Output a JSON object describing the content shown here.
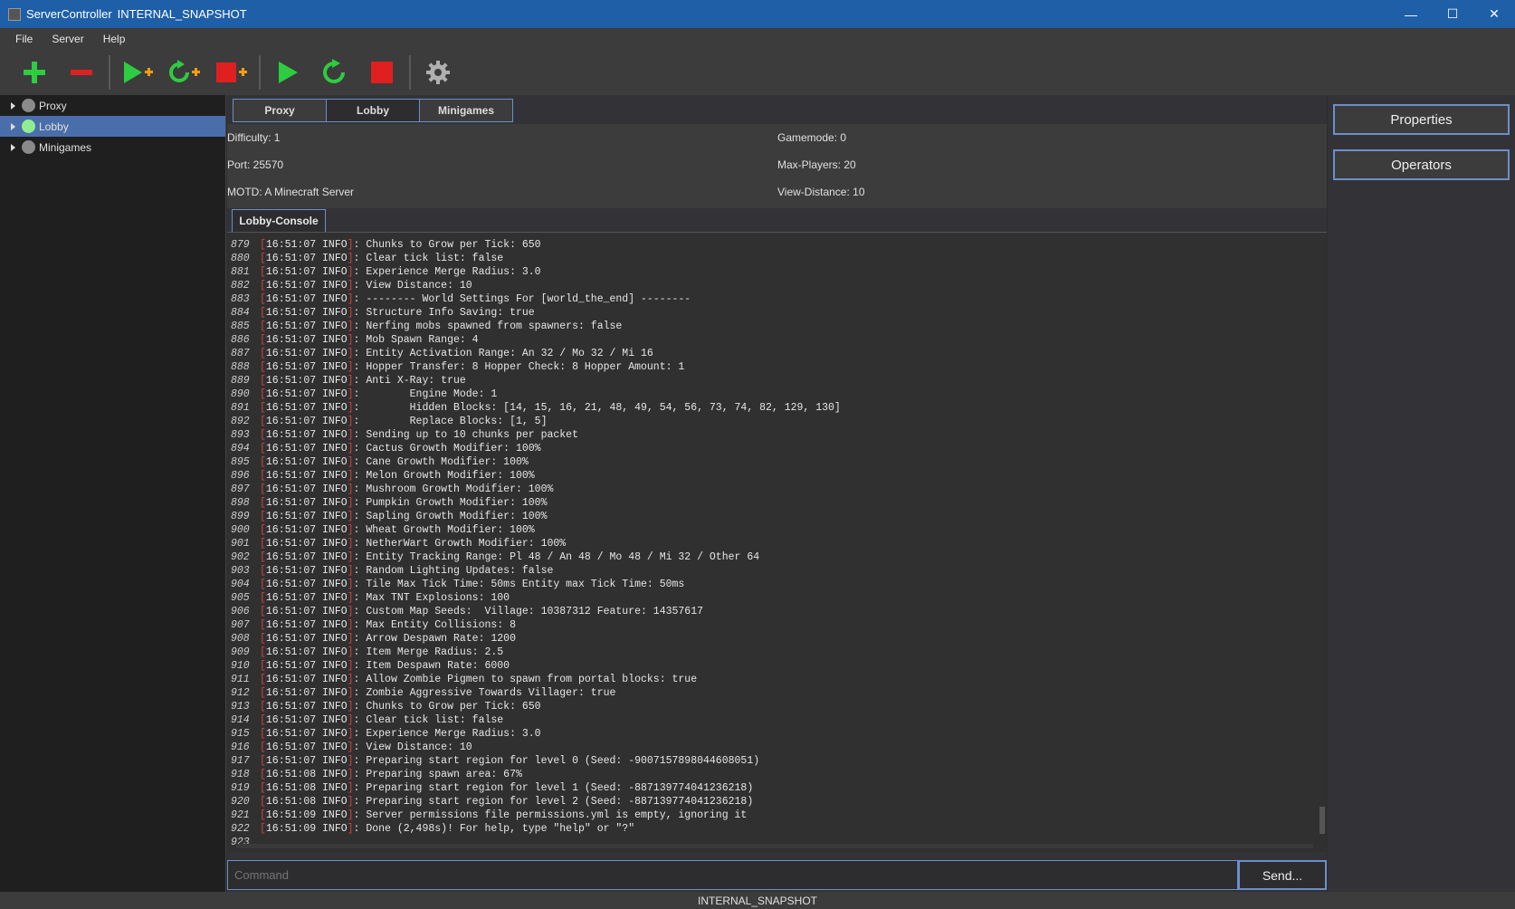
{
  "window": {
    "app_name": "ServerController",
    "title": "INTERNAL_SNAPSHOT",
    "minimize": "—",
    "maximize": "☐",
    "close": "✕"
  },
  "menu": [
    "File",
    "Server",
    "Help"
  ],
  "toolbar": {
    "icons": [
      "add-server-icon",
      "remove-server-icon",
      "start-all-icon",
      "restart-all-icon",
      "stop-all-icon",
      "start-icon",
      "restart-icon",
      "stop-icon",
      "settings-icon"
    ],
    "colors": {
      "green": "#2ecc40",
      "red": "#e02020",
      "orange": "#f39c12",
      "gray": "#b0b0b0"
    }
  },
  "tree": {
    "items": [
      {
        "label": "Proxy",
        "status_color": "#8a8a8a",
        "selected": false
      },
      {
        "label": "Lobby",
        "status_color": "#90ee90",
        "selected": true
      },
      {
        "label": "Minigames",
        "status_color": "#8a8a8a",
        "selected": false
      }
    ]
  },
  "tabs": [
    {
      "label": "Proxy",
      "active": false
    },
    {
      "label": "Lobby",
      "active": true
    },
    {
      "label": "Minigames",
      "active": false
    }
  ],
  "info": {
    "difficulty": "Difficulty: 1",
    "gamemode": "Gamemode: 0",
    "port": "Port: 25570",
    "max_players": "Max-Players: 20",
    "motd": "MOTD: A Minecraft Server",
    "view_distance": "View-Distance: 10"
  },
  "console": {
    "tab_label": "Lobby-Console",
    "lines": [
      {
        "n": "879",
        "t": "16:51:07",
        "lv": "INFO",
        "msg": ": Chunks to Grow per Tick: 650"
      },
      {
        "n": "880",
        "t": "16:51:07",
        "lv": "INFO",
        "msg": ": Clear tick list: false"
      },
      {
        "n": "881",
        "t": "16:51:07",
        "lv": "INFO",
        "msg": ": Experience Merge Radius: 3.0"
      },
      {
        "n": "882",
        "t": "16:51:07",
        "lv": "INFO",
        "msg": ": View Distance: 10"
      },
      {
        "n": "883",
        "t": "16:51:07",
        "lv": "INFO",
        "msg": ": -------- World Settings For [world_the_end] --------"
      },
      {
        "n": "884",
        "t": "16:51:07",
        "lv": "INFO",
        "msg": ": Structure Info Saving: true"
      },
      {
        "n": "885",
        "t": "16:51:07",
        "lv": "INFO",
        "msg": ": Nerfing mobs spawned from spawners: false"
      },
      {
        "n": "886",
        "t": "16:51:07",
        "lv": "INFO",
        "msg": ": Mob Spawn Range: 4"
      },
      {
        "n": "887",
        "t": "16:51:07",
        "lv": "INFO",
        "msg": ": Entity Activation Range: An 32 / Mo 32 / Mi 16"
      },
      {
        "n": "888",
        "t": "16:51:07",
        "lv": "INFO",
        "msg": ": Hopper Transfer: 8 Hopper Check: 8 Hopper Amount: 1"
      },
      {
        "n": "889",
        "t": "16:51:07",
        "lv": "INFO",
        "msg": ": Anti X-Ray: true"
      },
      {
        "n": "890",
        "t": "16:51:07",
        "lv": "INFO",
        "msg": ":        Engine Mode: 1"
      },
      {
        "n": "891",
        "t": "16:51:07",
        "lv": "INFO",
        "msg": ":        Hidden Blocks: [14, 15, 16, 21, 48, 49, 54, 56, 73, 74, 82, 129, 130]"
      },
      {
        "n": "892",
        "t": "16:51:07",
        "lv": "INFO",
        "msg": ":        Replace Blocks: [1, 5]"
      },
      {
        "n": "893",
        "t": "16:51:07",
        "lv": "INFO",
        "msg": ": Sending up to 10 chunks per packet"
      },
      {
        "n": "894",
        "t": "16:51:07",
        "lv": "INFO",
        "msg": ": Cactus Growth Modifier: 100%"
      },
      {
        "n": "895",
        "t": "16:51:07",
        "lv": "INFO",
        "msg": ": Cane Growth Modifier: 100%"
      },
      {
        "n": "896",
        "t": "16:51:07",
        "lv": "INFO",
        "msg": ": Melon Growth Modifier: 100%"
      },
      {
        "n": "897",
        "t": "16:51:07",
        "lv": "INFO",
        "msg": ": Mushroom Growth Modifier: 100%"
      },
      {
        "n": "898",
        "t": "16:51:07",
        "lv": "INFO",
        "msg": ": Pumpkin Growth Modifier: 100%"
      },
      {
        "n": "899",
        "t": "16:51:07",
        "lv": "INFO",
        "msg": ": Sapling Growth Modifier: 100%"
      },
      {
        "n": "900",
        "t": "16:51:07",
        "lv": "INFO",
        "msg": ": Wheat Growth Modifier: 100%"
      },
      {
        "n": "901",
        "t": "16:51:07",
        "lv": "INFO",
        "msg": ": NetherWart Growth Modifier: 100%"
      },
      {
        "n": "902",
        "t": "16:51:07",
        "lv": "INFO",
        "msg": ": Entity Tracking Range: Pl 48 / An 48 / Mo 48 / Mi 32 / Other 64"
      },
      {
        "n": "903",
        "t": "16:51:07",
        "lv": "INFO",
        "msg": ": Random Lighting Updates: false"
      },
      {
        "n": "904",
        "t": "16:51:07",
        "lv": "INFO",
        "msg": ": Tile Max Tick Time: 50ms Entity max Tick Time: 50ms"
      },
      {
        "n": "905",
        "t": "16:51:07",
        "lv": "INFO",
        "msg": ": Max TNT Explosions: 100"
      },
      {
        "n": "906",
        "t": "16:51:07",
        "lv": "INFO",
        "msg": ": Custom Map Seeds:  Village: 10387312 Feature: 14357617"
      },
      {
        "n": "907",
        "t": "16:51:07",
        "lv": "INFO",
        "msg": ": Max Entity Collisions: 8"
      },
      {
        "n": "908",
        "t": "16:51:07",
        "lv": "INFO",
        "msg": ": Arrow Despawn Rate: 1200"
      },
      {
        "n": "909",
        "t": "16:51:07",
        "lv": "INFO",
        "msg": ": Item Merge Radius: 2.5"
      },
      {
        "n": "910",
        "t": "16:51:07",
        "lv": "INFO",
        "msg": ": Item Despawn Rate: 6000"
      },
      {
        "n": "911",
        "t": "16:51:07",
        "lv": "INFO",
        "msg": ": Allow Zombie Pigmen to spawn from portal blocks: true"
      },
      {
        "n": "912",
        "t": "16:51:07",
        "lv": "INFO",
        "msg": ": Zombie Aggressive Towards Villager: true"
      },
      {
        "n": "913",
        "t": "16:51:07",
        "lv": "INFO",
        "msg": ": Chunks to Grow per Tick: 650"
      },
      {
        "n": "914",
        "t": "16:51:07",
        "lv": "INFO",
        "msg": ": Clear tick list: false"
      },
      {
        "n": "915",
        "t": "16:51:07",
        "lv": "INFO",
        "msg": ": Experience Merge Radius: 3.0"
      },
      {
        "n": "916",
        "t": "16:51:07",
        "lv": "INFO",
        "msg": ": View Distance: 10"
      },
      {
        "n": "917",
        "t": "16:51:07",
        "lv": "INFO",
        "msg": ": Preparing start region for level 0 (Seed: -9007157898044608051)"
      },
      {
        "n": "918",
        "t": "16:51:08",
        "lv": "INFO",
        "msg": ": Preparing spawn area: 67%"
      },
      {
        "n": "919",
        "t": "16:51:08",
        "lv": "INFO",
        "msg": ": Preparing start region for level 1 (Seed: -887139774041236218)"
      },
      {
        "n": "920",
        "t": "16:51:08",
        "lv": "INFO",
        "msg": ": Preparing start region for level 2 (Seed: -887139774041236218)"
      },
      {
        "n": "921",
        "t": "16:51:09",
        "lv": "INFO",
        "msg": ": Server permissions file permissions.yml is empty, ignoring it"
      },
      {
        "n": "922",
        "t": "16:51:09",
        "lv": "INFO",
        "msg": ": Done (2,498s)! For help, type \"help\" or \"?\""
      },
      {
        "n": "923",
        "t": "",
        "lv": "",
        "msg": ""
      }
    ]
  },
  "command": {
    "placeholder": "Command",
    "send_label": "Send..."
  },
  "right": {
    "properties_label": "Properties",
    "operators_label": "Operators"
  },
  "statusbar": {
    "text": "INTERNAL_SNAPSHOT"
  }
}
